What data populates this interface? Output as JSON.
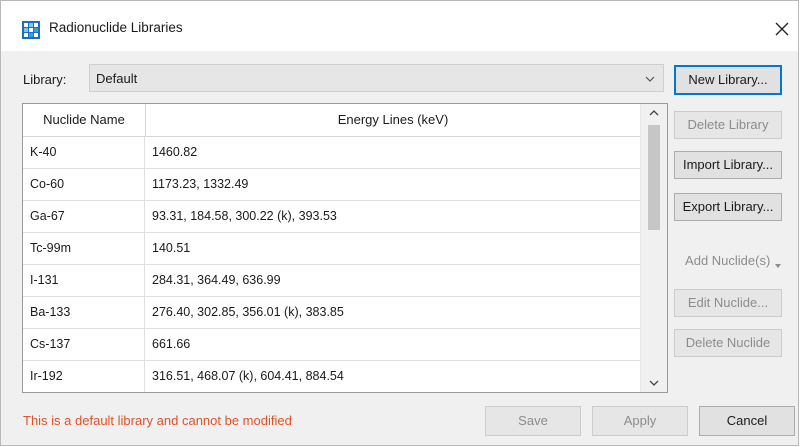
{
  "window": {
    "title": "Radionuclide Libraries",
    "close_icon": "close-icon",
    "app_icon": "radionuclide-app-icon"
  },
  "library": {
    "label": "Library:",
    "selected": "Default"
  },
  "table": {
    "headers": [
      "Nuclide Name",
      "Energy Lines (keV)"
    ],
    "rows": [
      {
        "name": "K-40",
        "energy": "1460.82"
      },
      {
        "name": "Co-60",
        "energy": "1173.23, 1332.49"
      },
      {
        "name": "Ga-67",
        "energy": "93.31, 184.58, 300.22 (k), 393.53"
      },
      {
        "name": "Tc-99m",
        "energy": "140.51"
      },
      {
        "name": "I-131",
        "energy": "284.31, 364.49, 636.99"
      },
      {
        "name": "Ba-133",
        "energy": "276.40, 302.85, 356.01 (k), 383.85"
      },
      {
        "name": "Cs-137",
        "energy": "661.66"
      },
      {
        "name": "Ir-192",
        "energy": "316.51, 468.07 (k), 604.41, 884.54"
      }
    ]
  },
  "side_buttons": {
    "new_library": "New Library...",
    "delete_library": "Delete Library",
    "import_library": "Import Library...",
    "export_library": "Export Library...",
    "add_nuclides": "Add Nuclide(s)",
    "edit_nuclide": "Edit Nuclide...",
    "delete_nuclide": "Delete Nuclide"
  },
  "footer": {
    "message": "This is a default library and cannot be modified",
    "save": "Save",
    "apply": "Apply",
    "cancel": "Cancel"
  },
  "colors": {
    "accent": "#0078d7",
    "warning_text": "#e0532a",
    "dialog_bg": "#f0f0f0"
  }
}
